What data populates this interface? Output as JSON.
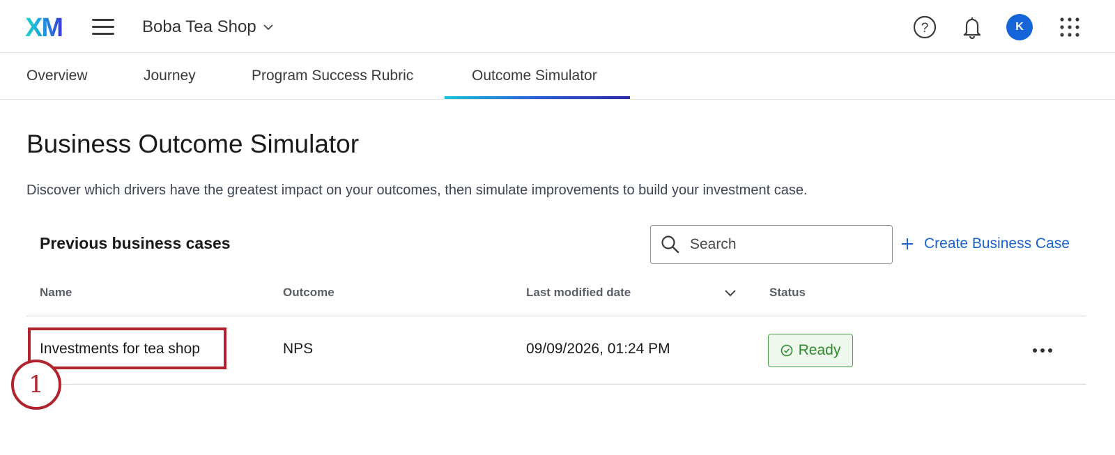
{
  "header": {
    "logo_text": "XM",
    "project_name": "Boba Tea Shop",
    "icons": [
      "help-icon",
      "bell-icon",
      "apps-grid-icon"
    ],
    "avatar_initial": "K"
  },
  "tabs": [
    {
      "label": "Overview",
      "active": false
    },
    {
      "label": "Journey",
      "active": false
    },
    {
      "label": "Program Success Rubric",
      "active": false
    },
    {
      "label": "Outcome Simulator",
      "active": true
    }
  ],
  "page": {
    "title": "Business Outcome Simulator",
    "description": "Discover which drivers have the greatest impact on your outcomes, then simulate improvements to build your investment case."
  },
  "section": {
    "title": "Previous business cases",
    "search_placeholder": "Search",
    "create_label": "Create Business Case"
  },
  "table": {
    "columns": [
      "Name",
      "Outcome",
      "Last modified date",
      "Status"
    ],
    "rows": [
      {
        "name": "Investments for tea shop",
        "outcome": "NPS",
        "modified": "09/09/2026, 01:24 PM",
        "status": "Ready"
      }
    ]
  },
  "annotation": {
    "number": "1"
  },
  "colors": {
    "accent_blue": "#1663d1",
    "avatar_blue": "#1565d8",
    "ready_green": "#2e8a2e",
    "annotation_red": "#b1232f"
  }
}
